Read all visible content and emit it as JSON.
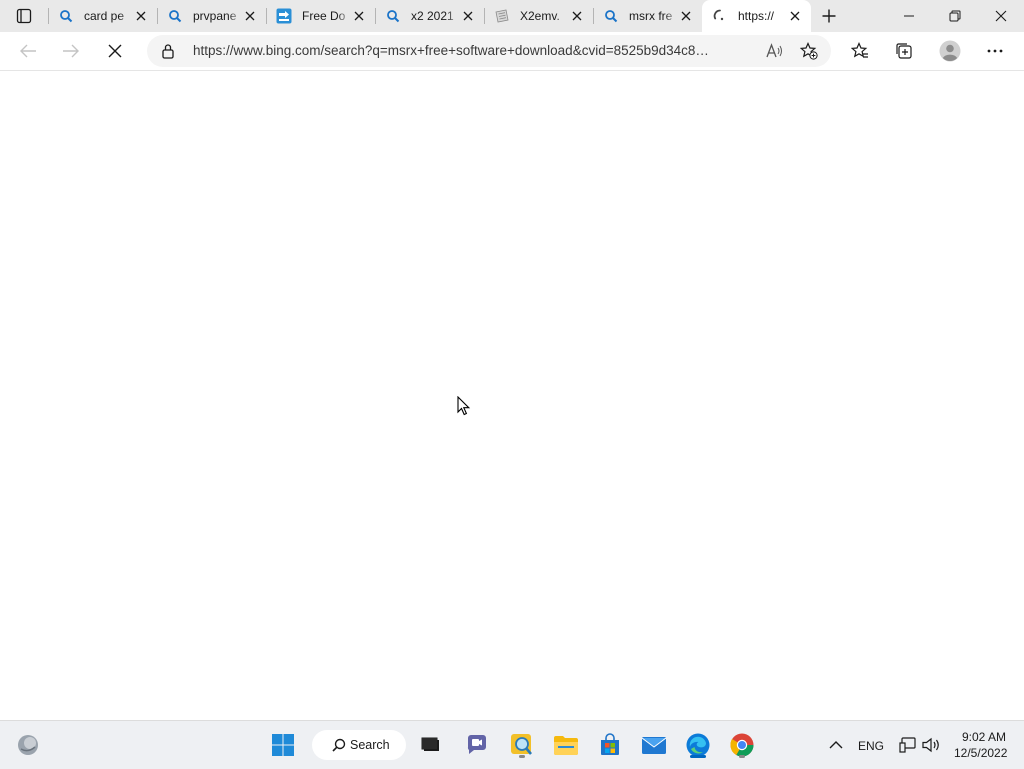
{
  "tabs": [
    {
      "title": "card pe",
      "favicon": "bing-search-icon"
    },
    {
      "title": "prvpane",
      "favicon": "bing-search-icon"
    },
    {
      "title": "Free Do",
      "favicon": "download-site-icon"
    },
    {
      "title": "x2 2021",
      "favicon": "bing-search-icon"
    },
    {
      "title": "X2emv.",
      "favicon": "document-icon"
    },
    {
      "title": "msrx fre",
      "favicon": "bing-search-icon"
    },
    {
      "title": "https://",
      "favicon": "loading-spinner-icon",
      "active": true
    }
  ],
  "address": {
    "url": "https://www.bing.com/search?q=msrx+free+software+download&cvid=8525b9d34c884..."
  },
  "taskbar": {
    "search_label": "Search",
    "language": "ENG",
    "time": "9:02 AM",
    "date": "12/5/2022"
  },
  "colors": {
    "tabstrip_bg": "#e9e9e9",
    "accent": "#0067c0",
    "taskbar_bg": "#eef0f3"
  }
}
